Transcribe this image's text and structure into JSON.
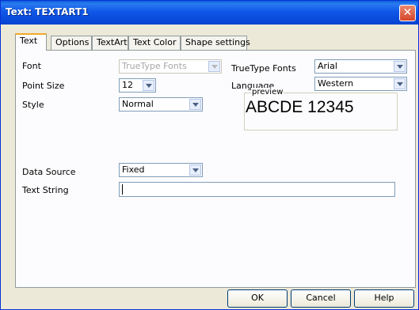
{
  "window": {
    "title": "Text: TEXTART1",
    "close_glyph": "✕"
  },
  "tabs": [
    {
      "label": "Text",
      "active": true
    },
    {
      "label": "Options"
    },
    {
      "label": "TextArt"
    },
    {
      "label": "Text Color"
    },
    {
      "label": "Shape settings"
    }
  ],
  "form": {
    "font_label": "Font",
    "font_value": "TrueType Fonts",
    "point_size_label": "Point Size",
    "point_size_value": "12",
    "style_label": "Style",
    "style_value": "Normal",
    "truetype_label": "TrueType Fonts",
    "truetype_value": "Arial",
    "language_label": "Language",
    "language_value": "Western",
    "data_source_label": "Data Source",
    "data_source_value": "Fixed",
    "text_string_label": "Text String",
    "text_string_value": ""
  },
  "preview": {
    "legend": "preview",
    "sample": "ABCDE 12345"
  },
  "buttons": {
    "ok": "OK",
    "cancel": "Cancel",
    "help": "Help"
  }
}
